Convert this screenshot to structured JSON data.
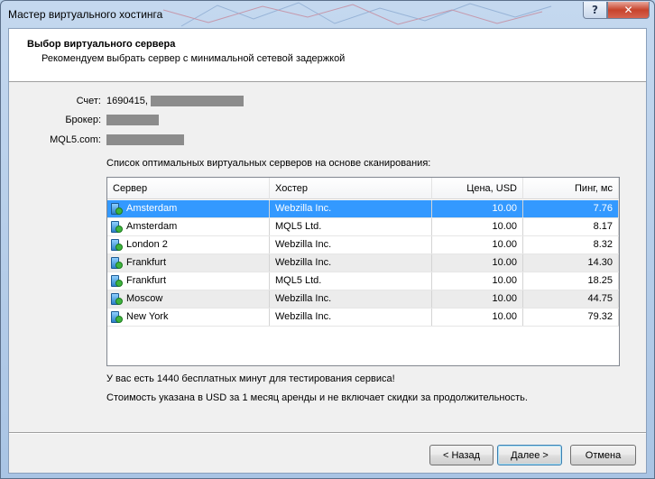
{
  "window": {
    "title": "Мастер виртуального хостинга",
    "help_glyph": "?",
    "close_glyph": "✕"
  },
  "header": {
    "title": "Выбор виртуального сервера",
    "subtitle": "Рекомендуем выбрать сервер с минимальной сетевой задержкой"
  },
  "account": {
    "label": "Счет:",
    "value": "1690415,"
  },
  "broker": {
    "label": "Брокер:"
  },
  "mql5": {
    "label": "MQL5.com:"
  },
  "list": {
    "caption": "Список оптимальных виртуальных серверов на основе сканирования:",
    "columns": [
      "Сервер",
      "Хостер",
      "Цена, USD",
      "Пинг, мс"
    ],
    "rows": [
      {
        "server": "Amsterdam",
        "host": "Webzilla Inc.",
        "price": "10.00",
        "ping": "7.76"
      },
      {
        "server": "Amsterdam",
        "host": "MQL5 Ltd.",
        "price": "10.00",
        "ping": "8.17"
      },
      {
        "server": "London 2",
        "host": "Webzilla Inc.",
        "price": "10.00",
        "ping": "8.32"
      },
      {
        "server": "Frankfurt",
        "host": "Webzilla Inc.",
        "price": "10.00",
        "ping": "14.30"
      },
      {
        "server": "Frankfurt",
        "host": "MQL5 Ltd.",
        "price": "10.00",
        "ping": "18.25"
      },
      {
        "server": "Moscow",
        "host": "Webzilla Inc.",
        "price": "10.00",
        "ping": "44.75"
      },
      {
        "server": "New York",
        "host": "Webzilla Inc.",
        "price": "10.00",
        "ping": "79.32"
      }
    ]
  },
  "notes": {
    "free_minutes": "У вас есть 1440 бесплатных минут для тестирования сервиса!",
    "price_info": "Стоимость указана в USD за 1 месяц аренды и не включает скидки за продолжительность."
  },
  "buttons": {
    "back": "< Назад",
    "next": "Далее >",
    "cancel": "Отмена"
  },
  "colors": {
    "selection": "#3399ff",
    "titlebar": "#b9d1ea"
  },
  "icons": {
    "server": "server-ok-icon"
  }
}
